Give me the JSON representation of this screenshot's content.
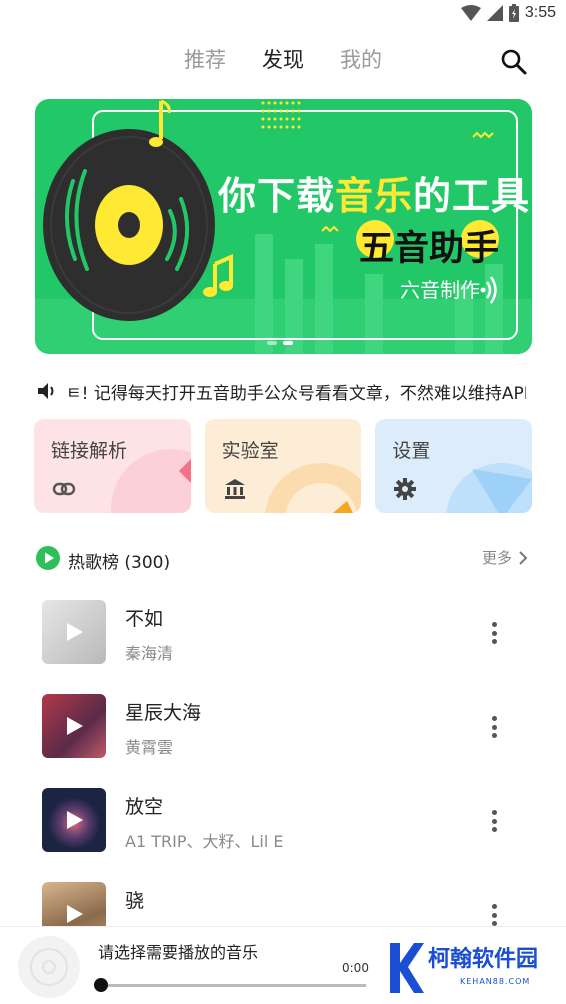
{
  "status_bar": {
    "time": "3:55"
  },
  "nav": {
    "tabs": [
      {
        "label": "推荐",
        "active": false
      },
      {
        "label": "发现",
        "active": true
      },
      {
        "label": "我的",
        "active": false
      }
    ]
  },
  "banner": {
    "line1_a": "你下载",
    "line1_b": "音乐",
    "line1_c": "的工具",
    "line2": "五音助手",
    "line3": "六音制作",
    "bg_color": "#22c868",
    "accent_color": "#ffe933"
  },
  "notice": {
    "text": "ㅌ! 记得每天打开五音助手公众号看看文章，不然难以维持APP运营"
  },
  "cards": [
    {
      "label": "链接解析",
      "icon": "link-icon",
      "bg": "#fde3e6"
    },
    {
      "label": "实验室",
      "icon": "bank-icon",
      "bg": "#fdecd6"
    },
    {
      "label": "设置",
      "icon": "gear-icon",
      "bg": "#dcecfb"
    }
  ],
  "hot_list": {
    "title": "热歌榜 (300)",
    "more_label": "更多"
  },
  "songs": [
    {
      "title": "不如",
      "artist": "秦海清"
    },
    {
      "title": "星辰大海",
      "artist": "黄霄雲"
    },
    {
      "title": "放空",
      "artist": "A1 TRIP、大籽、Lil E"
    },
    {
      "title": "骁",
      "artist": ""
    }
  ],
  "player": {
    "prompt": "请选择需要播放的音乐",
    "time": "0:00",
    "progress": 0
  },
  "watermark": {
    "name": "柯翰软件园",
    "domain": "KEHAN88.COM"
  }
}
